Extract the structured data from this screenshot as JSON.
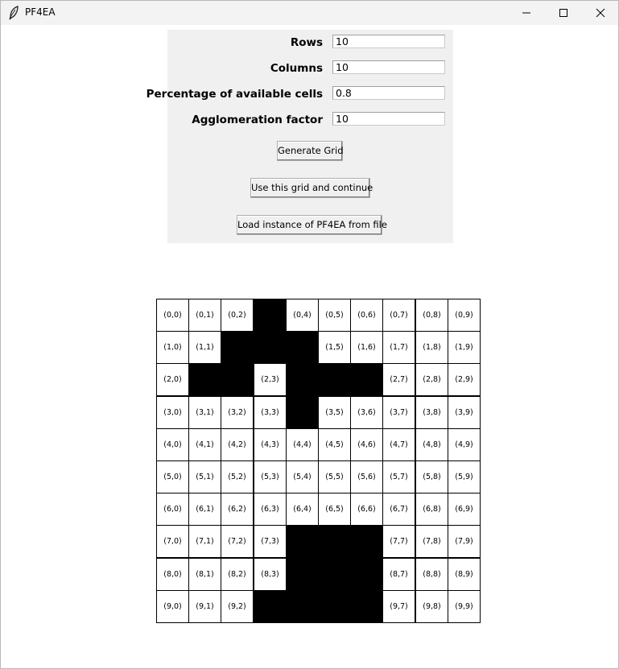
{
  "window": {
    "title": "PF4EA",
    "icon": "feather-icon"
  },
  "form": {
    "rows_label": "Rows",
    "rows_value": "10",
    "columns_label": "Columns",
    "columns_value": "10",
    "percentage_label": "Percentage of available cells",
    "percentage_value": "0.8",
    "agglomeration_label": "Agglomeration factor",
    "agglomeration_value": "10",
    "generate_label": "Generate Grid",
    "continue_label": "Use this grid and continue",
    "load_label": "Load instance of PF4EA from file"
  },
  "grid": {
    "rows": 10,
    "cols": 10,
    "blocked_color": "#000000",
    "free_color": "#ffffff",
    "blocked_cells": [
      [
        0,
        3
      ],
      [
        1,
        2
      ],
      [
        1,
        3
      ],
      [
        1,
        4
      ],
      [
        2,
        1
      ],
      [
        2,
        2
      ],
      [
        2,
        4
      ],
      [
        2,
        5
      ],
      [
        2,
        6
      ],
      [
        3,
        4
      ],
      [
        7,
        4
      ],
      [
        7,
        5
      ],
      [
        7,
        6
      ],
      [
        8,
        4
      ],
      [
        8,
        5
      ],
      [
        8,
        6
      ],
      [
        9,
        3
      ],
      [
        9,
        4
      ],
      [
        9,
        5
      ],
      [
        9,
        6
      ]
    ]
  }
}
